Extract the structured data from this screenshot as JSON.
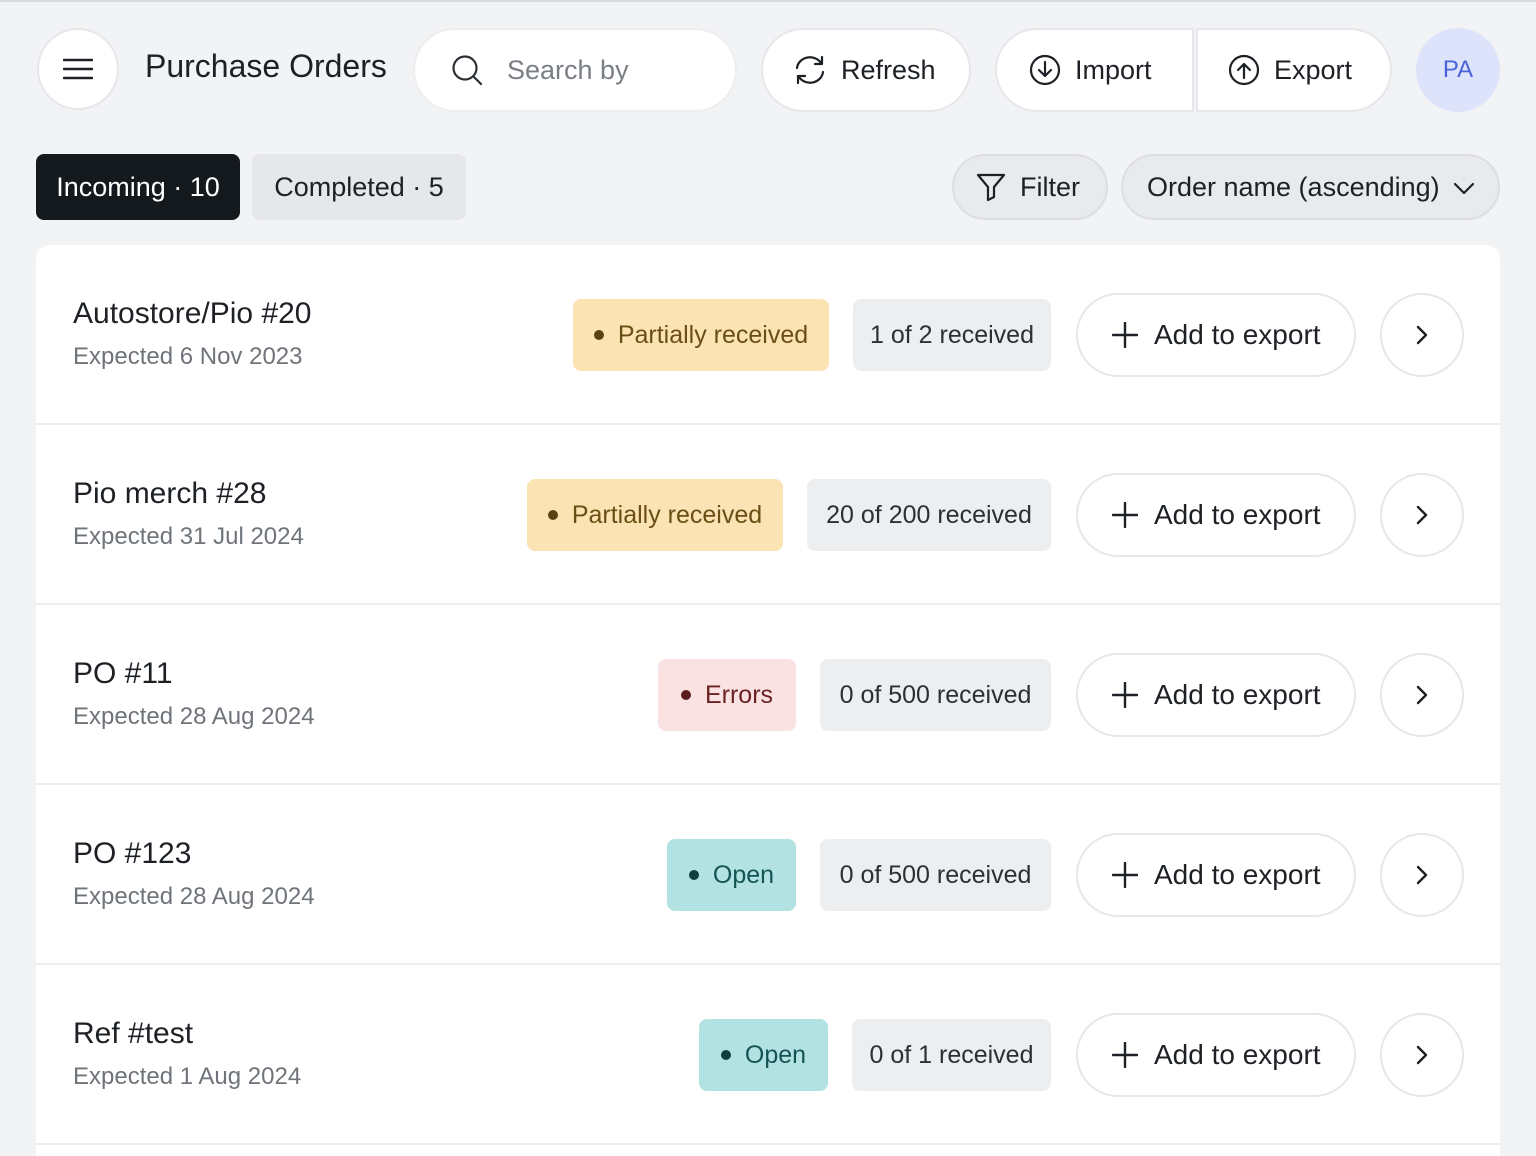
{
  "header": {
    "menu_icon": "hamburger-menu-icon",
    "title": "Purchase Orders",
    "search_placeholder": "Search by order name",
    "search_visible_text": "Search by o",
    "refresh_label": "Refresh",
    "import_label": "Import",
    "export_label": "Export",
    "avatar_initials": "PA"
  },
  "tabs": [
    {
      "label": "Incoming · 10",
      "active": true
    },
    {
      "label": "Completed · 5",
      "active": false
    }
  ],
  "toolbar": {
    "filter_label": "Filter",
    "sort_value": "Order name (ascending)"
  },
  "colors": {
    "partial_bg": "#fbe3b3",
    "errors_bg": "#fbe2e2",
    "open_bg": "#b3e2e3",
    "active_tab_bg": "#14191d",
    "avatar_bg": "#dde3fb"
  },
  "orders": [
    {
      "name": "Autostore/Pio #20",
      "expected": "Expected 6 Nov 2023",
      "status": "Partially received",
      "status_kind": "partial",
      "received": "1 of 2 received",
      "action": "Add to export"
    },
    {
      "name": "Pio merch #28",
      "expected": "Expected 31 Jul 2024",
      "status": "Partially received",
      "status_kind": "partial",
      "received": "20 of 200 received",
      "action": "Add to export"
    },
    {
      "name": "PO #11",
      "expected": "Expected 28 Aug 2024",
      "status": "Errors",
      "status_kind": "errors",
      "received": "0 of 500 received",
      "action": "Add to export"
    },
    {
      "name": "PO #123",
      "expected": "Expected 28 Aug 2024",
      "status": "Open",
      "status_kind": "open",
      "received": "0 of 500 received",
      "action": "Add to export"
    },
    {
      "name": "Ref #test",
      "expected": "Expected 1 Aug 2024",
      "status": "Open",
      "status_kind": "open",
      "received": "0 of 1 received",
      "action": "Add to export"
    }
  ]
}
